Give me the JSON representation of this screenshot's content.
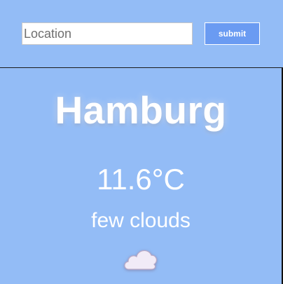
{
  "search": {
    "placeholder": "Location",
    "value": "",
    "submit_label": "submit"
  },
  "weather": {
    "city": "Hamburg",
    "temperature": "11.6°C",
    "description": "few clouds",
    "icon": "cloud-icon"
  },
  "colors": {
    "background": "#93bcf6",
    "button": "#6a9bf2",
    "text": "#ffffff",
    "cloud_fill": "#f1ebf7"
  }
}
